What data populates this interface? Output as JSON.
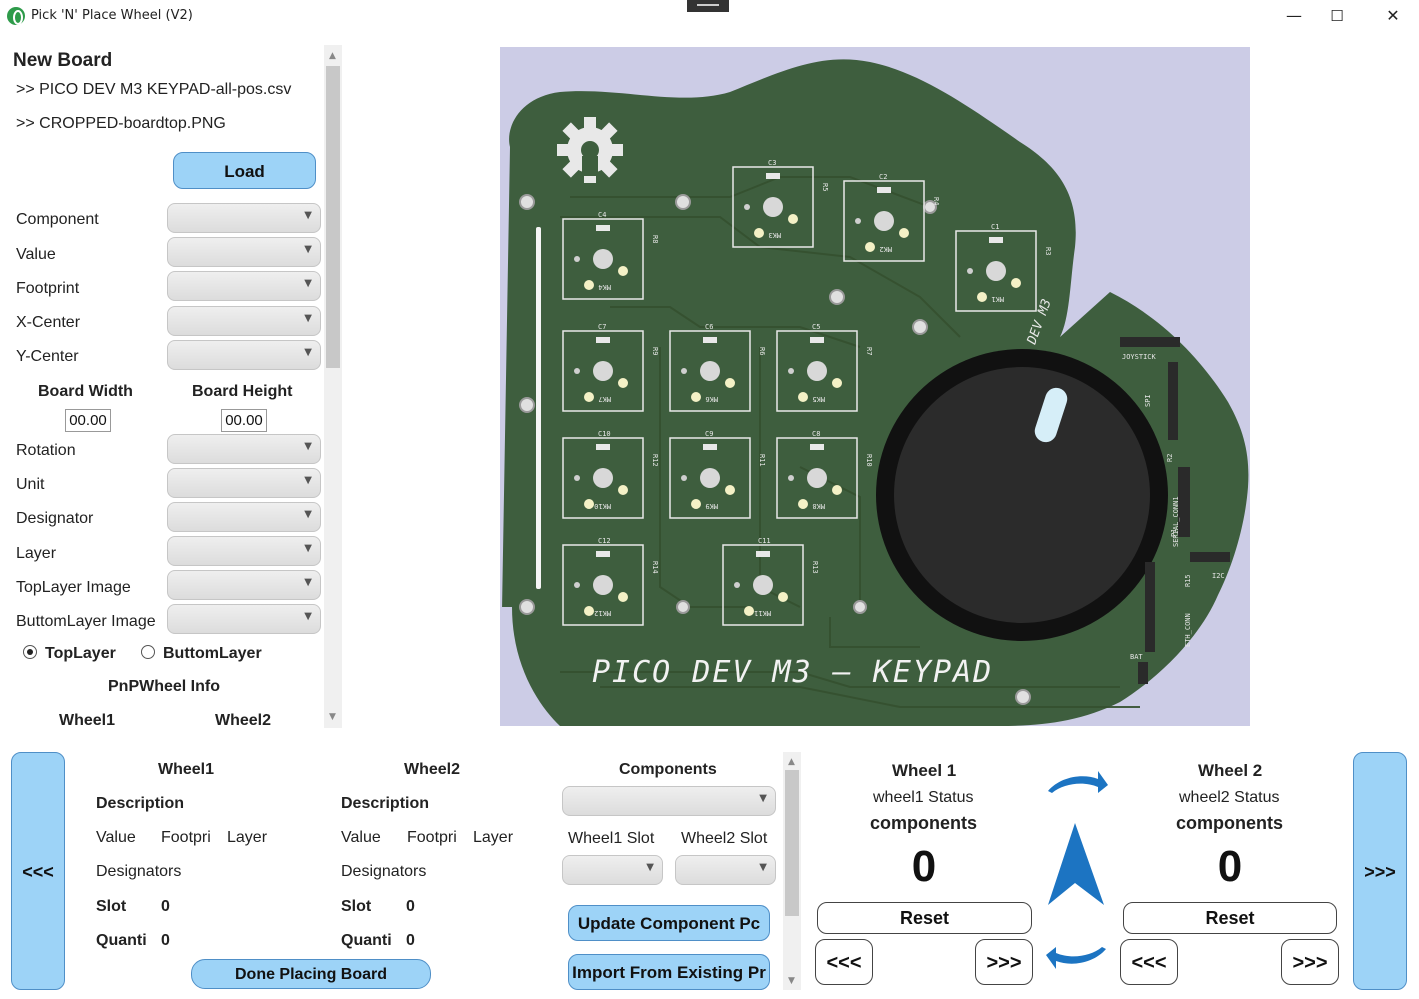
{
  "window": {
    "title": "Pick 'N' Place Wheel (V2)",
    "minimize": "—",
    "maximize": "☐",
    "close": "✕"
  },
  "left": {
    "heading": "New Board",
    "file_pos": ">> PICO DEV M3 KEYPAD-all-pos.csv",
    "file_img": ">> CROPPED-boardtop.PNG",
    "load_label": "Load",
    "fields": {
      "component": "Component",
      "value": "Value",
      "footprint": "Footprint",
      "x_center": "X-Center",
      "y_center": "Y-Center",
      "rotation": "Rotation",
      "unit": "Unit",
      "designator": "Designator",
      "layer": "Layer",
      "toplayer_image": "TopLayer Image",
      "buttomlayer_image": "ButtomLayer Image"
    },
    "board_width_label": "Board Width",
    "board_height_label": "Board Height",
    "board_width_value": "00.00",
    "board_height_value": "00.00",
    "radio_top": "TopLayer",
    "radio_bottom": "ButtomLayer",
    "selected_layer": "TopLayer",
    "pnp_info": "PnPWheel Info",
    "wheel1": "Wheel1",
    "wheel2": "Wheel2"
  },
  "board": {
    "silkscreen_title": "PICO DEV M3 — KEYPAD",
    "rotated_label": "DEV M3",
    "colors": {
      "pcb": "#3e5e3e",
      "background": "#cccce6",
      "knob": "#2b2b2b"
    },
    "keys": [
      {
        "top": "C4",
        "bottom": "MK4",
        "r": "R8"
      },
      {
        "top": "C3",
        "bottom": "MK3",
        "r": "R5"
      },
      {
        "top": "C2",
        "bottom": "MK2",
        "r": "R4"
      },
      {
        "top": "C1",
        "bottom": "MK1",
        "r": "R3"
      },
      {
        "top": "C7",
        "bottom": "MK7",
        "r": "R9"
      },
      {
        "top": "C6",
        "bottom": "MK6",
        "r": "R6"
      },
      {
        "top": "C5",
        "bottom": "MK5",
        "r": "R7"
      },
      {
        "top": "C10",
        "bottom": "MK10",
        "r": "R12"
      },
      {
        "top": "C9",
        "bottom": "MK9",
        "r": "R11"
      },
      {
        "top": "C8",
        "bottom": "MK8",
        "r": "R10"
      },
      {
        "top": "C12",
        "bottom": "MK12",
        "r": "R14"
      },
      {
        "top": "C11",
        "bottom": "MK11",
        "r": "R13"
      }
    ],
    "joystick_pins": [
      "3V3",
      "A3",
      "A2",
      "23",
      "G"
    ],
    "joystick_label": "JOYSTICK",
    "spi_pins": [
      "1",
      "18",
      "19",
      "0",
      "5V",
      "G"
    ],
    "spi_label": "SPI",
    "serial_label": "SERIAL_CONN1",
    "i2c_pins": [
      "G",
      "3V3",
      "21",
      "20"
    ],
    "i2c_label": "I2C",
    "eth_pins": [
      "3V3",
      "16",
      "17",
      "21",
      "20",
      "18",
      "5V",
      "G"
    ],
    "eth_label": "ETH_CONN",
    "bat_label": "BAT",
    "bat_pins": [
      "+",
      "G"
    ],
    "misc_labels": {
      "r2": "R2",
      "p1": "P1",
      "r15": "R15"
    }
  },
  "bottom": {
    "prev_label": "<<<",
    "next_label": ">>>",
    "wheel1": {
      "title": "Wheel1",
      "description": "Description",
      "value": "Value",
      "footprint": "Footpri",
      "layer": "Layer",
      "designators": "Designators",
      "slot_label": "Slot",
      "slot_value": "0",
      "quantity_label": "Quanti",
      "quantity_value": "0"
    },
    "wheel2": {
      "title": "Wheel2",
      "description": "Description",
      "value": "Value",
      "footprint": "Footpri",
      "layer": "Layer",
      "designators": "Designators",
      "slot_label": "Slot",
      "slot_value": "0",
      "quantity_label": "Quanti",
      "quantity_value": "0"
    },
    "done_label": "Done Placing Board",
    "components_title": "Components",
    "wheel1_slot": "Wheel1 Slot",
    "wheel2_slot": "Wheel2 Slot",
    "update_label": "Update Component Pc",
    "import_label": "Import From Existing Pr",
    "status1": {
      "title": "Wheel 1",
      "status": "wheel1 Status",
      "components": "components",
      "count": "0",
      "reset": "Reset",
      "prev": "<<<",
      "next": ">>>"
    },
    "status2": {
      "title": "Wheel 2",
      "status": "wheel2 Status",
      "components": "components",
      "count": "0",
      "reset": "Reset",
      "prev": "<<<",
      "next": ">>>"
    }
  }
}
